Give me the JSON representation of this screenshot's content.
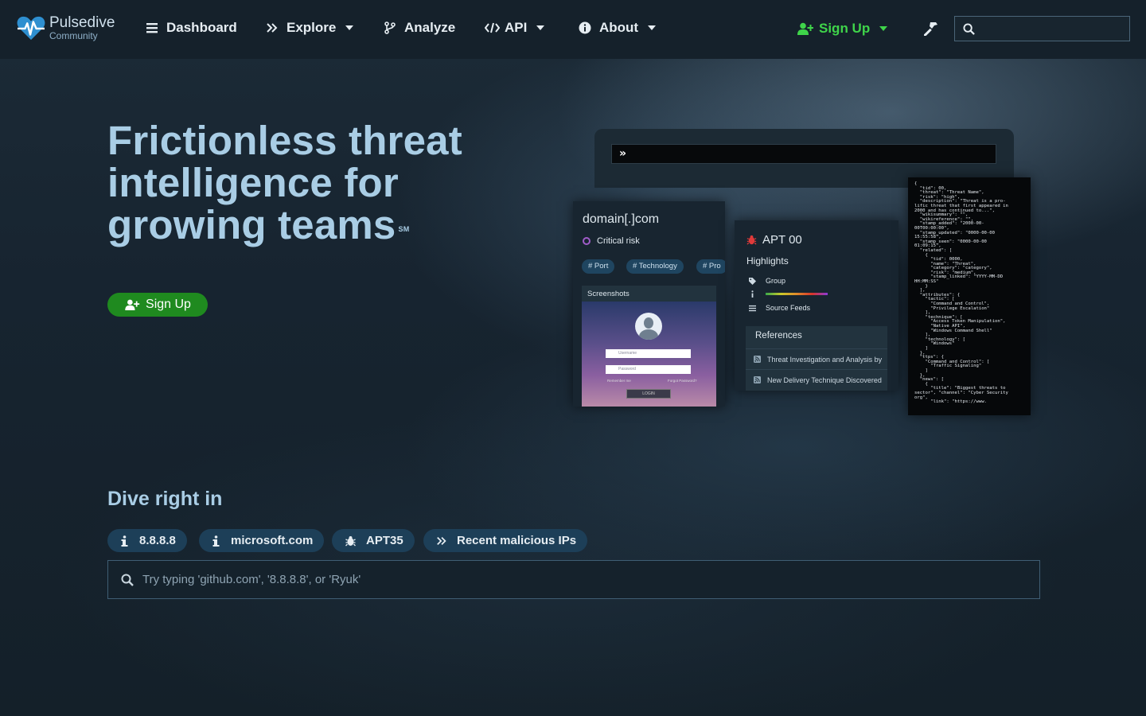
{
  "brand": {
    "name": "Pulsedive",
    "sub": "Community"
  },
  "nav": {
    "dashboard": "Dashboard",
    "explore": "Explore",
    "analyze": "Analyze",
    "api": "API",
    "about": "About",
    "signup": "Sign Up",
    "search_value": ""
  },
  "hero": {
    "title_line1": "Frictionless threat",
    "title_line2": "intelligence for",
    "title_line3": "growing teams",
    "title_mark": "SM",
    "signup": "Sign Up"
  },
  "mockup": {
    "bar_glyph": "»",
    "domain_card": {
      "title": "domain[.]com",
      "risk": "Critical risk",
      "tags": [
        "# Port",
        "# Technology",
        "# Pro"
      ],
      "screenshots_label": "Screenshots",
      "login": {
        "username": "Username",
        "password": "Password",
        "remember": "Remember me",
        "forgot": "Forgot Password?",
        "button": "LOGIN"
      }
    },
    "apt_card": {
      "title": "APT 00",
      "highlights": "Highlights",
      "group": "Group",
      "source_feeds": "Source Feeds",
      "references_title": "References",
      "references": [
        "Threat Investigation and Analysis by",
        "New Delivery Technique Discovered"
      ]
    },
    "json_text": "{\n  \"tid\": 00,\n  \"threat\": \"Threat Name\",\n  \"risk\": \"high\",\n  \"description\": \"Threat is a pro-\nlific threat that first appeared in\n2000 and has continued to...\",\n  \"wikisummary\": \"\",\n  \"wikireference\": \"\",\n  \"stamp_added\": \"2000-00-\n00T00:00:00\",\n  \"stamp_updated\": \"0000-00-00\n15:55:58\",\n  \"stamp_seen\": \"0000-00-00\n01:09:15\",\n  \"related\": [\n    {\n      \"tid\": 0000,\n      \"name\": \"Threat\",\n      \"category\": \"category\",\n      \"risk\": \"medium\",\n      \"stamp_linked\": \"YYYY-MM-DD\nHH:MM:SS\"\n    }\n  ],\n  \"attributes\": {\n    \"tactic\": [\n      \"Command and Control\",\n      \"Privilege Escalation\"\n    ],\n    \"technique\": [\n      \"Access Token Manipulation\",\n      \"Native API\",\n      \"Windows Command Shell\"\n    ],\n    \"technology\": [\n      \"Windows\"\n    ]\n  },\n  \"ttps\": {\n    \"Command and Control\": [\n      \"Traffic Signaling\"\n    ]\n  },\n  \"news\": [\n    {\n      \"title\": \"Biggest threats to\nsector\", \"channel\": \"Cyber Security\norg\",\n      \"link\": \"https://www."
  },
  "dive": {
    "title": "Dive right in",
    "chips": [
      "8.8.8.8",
      "microsoft.com",
      "APT35",
      "Recent malicious IPs"
    ],
    "search_placeholder": "Try typing 'github.com', '8.8.8.8', or 'Ryuk'"
  },
  "colors": {
    "accent_title": "#a9cde5",
    "signup_green": "#1f8a1f",
    "nav_signup": "#3fd44a",
    "chip_bg": "#1d3f58"
  }
}
